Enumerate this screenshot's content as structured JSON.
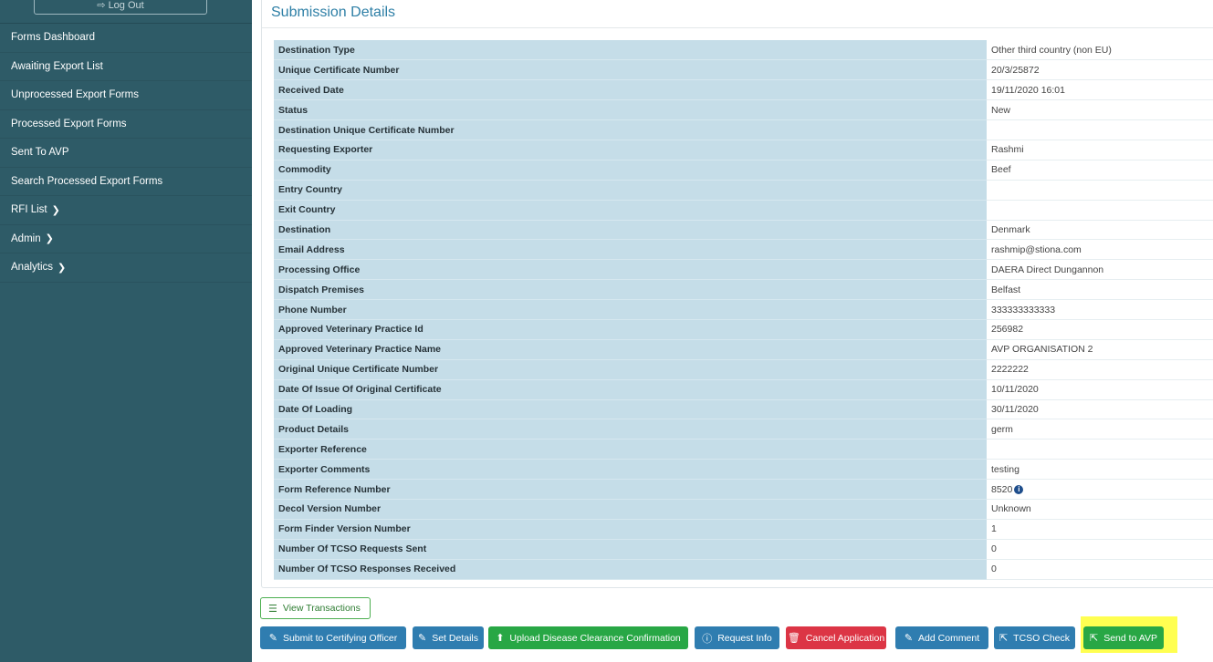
{
  "sidebar": {
    "logout_label": "Log Out",
    "items": [
      {
        "label": "Forms Dashboard",
        "chevron": ""
      },
      {
        "label": "Awaiting Export List",
        "chevron": ""
      },
      {
        "label": "Unprocessed Export Forms",
        "chevron": ""
      },
      {
        "label": "Processed Export Forms",
        "chevron": ""
      },
      {
        "label": "Sent To AVP",
        "chevron": ""
      },
      {
        "label": "Search Processed Export Forms",
        "chevron": ""
      },
      {
        "label": "RFI List",
        "chevron": "❯"
      },
      {
        "label": "Admin",
        "chevron": "❯"
      },
      {
        "label": "Analytics",
        "chevron": "❯"
      }
    ]
  },
  "panel": {
    "title": "Submission Details"
  },
  "details": [
    {
      "key": "Destination Type",
      "value": "Other third country (non EU)"
    },
    {
      "key": "Unique Certificate Number",
      "value": "20/3/25872"
    },
    {
      "key": "Received Date",
      "value": "19/11/2020 16:01"
    },
    {
      "key": "Status",
      "value": "New"
    },
    {
      "key": "Destination Unique Certificate Number",
      "value": ""
    },
    {
      "key": "Requesting Exporter",
      "value": "Rashmi"
    },
    {
      "key": "Commodity",
      "value": "Beef"
    },
    {
      "key": "Entry Country",
      "value": ""
    },
    {
      "key": "Exit Country",
      "value": ""
    },
    {
      "key": "Destination",
      "value": "Denmark"
    },
    {
      "key": "Email Address",
      "value": "rashmip@stiona.com"
    },
    {
      "key": "Processing Office",
      "value": "DAERA Direct Dungannon"
    },
    {
      "key": "Dispatch Premises",
      "value": "Belfast"
    },
    {
      "key": "Phone Number",
      "value": "333333333333"
    },
    {
      "key": "Approved Veterinary Practice Id",
      "value": "256982"
    },
    {
      "key": "Approved Veterinary Practice Name",
      "value": "AVP ORGANISATION 2"
    },
    {
      "key": "Original Unique Certificate Number",
      "value": "2222222"
    },
    {
      "key": "Date Of Issue Of Original Certificate",
      "value": "10/11/2020"
    },
    {
      "key": "Date Of Loading",
      "value": "30/11/2020"
    },
    {
      "key": "Product Details",
      "value": "germ"
    },
    {
      "key": "Exporter Reference",
      "value": ""
    },
    {
      "key": "Exporter Comments",
      "value": "testing"
    },
    {
      "key": "Form Reference Number",
      "value": "8520"
    },
    {
      "key": "Decol Version Number",
      "value": "Unknown"
    },
    {
      "key": "Form Finder Version Number",
      "value": "1"
    },
    {
      "key": "Number Of TCSO Requests Sent",
      "value": "0"
    },
    {
      "key": "Number Of TCSO Responses Received",
      "value": "0"
    }
  ],
  "form_reference_info_icon": "info-circle-icon",
  "actions": {
    "view_transactions": "View Transactions",
    "submit_to_certifying_officer": "Submit to Certifying Officer",
    "set_details": "Set Details",
    "upload_disease_clearance": "Upload Disease Clearance Confirmation",
    "request_info": "Request Info",
    "cancel_application": "Cancel Application",
    "add_comment": "Add Comment",
    "tcso_check": "TCSO Check",
    "send_to_avp": "Send to AVP"
  },
  "colors": {
    "sidebar_bg": "#2e5b67",
    "header_text": "#2e7fa6",
    "key_cell_bg": "#c5dde8",
    "btn_blue": "#2f7db0",
    "btn_green": "#28a745",
    "btn_red": "#dc3545",
    "highlight": "#ffff33"
  }
}
